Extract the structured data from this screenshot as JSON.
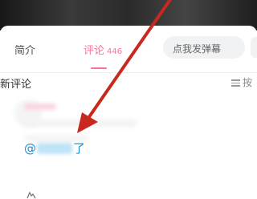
{
  "tabs": {
    "intro_label": "简介",
    "comments_label": "评论",
    "comments_count": "446"
  },
  "danmaku": {
    "placeholder": "点我发弹幕"
  },
  "comment_list": {
    "sort_title": "新评论",
    "sort_button_label": "按"
  },
  "comment": {
    "mention_prefix": "@",
    "mention_suffix": "了"
  },
  "colors": {
    "accent": "#fb7299",
    "mention": "#178bcf",
    "annotation_arrow": "#c8281e"
  },
  "icons": {
    "sort": "menu-lines-icon",
    "reply": "reply-icon"
  }
}
